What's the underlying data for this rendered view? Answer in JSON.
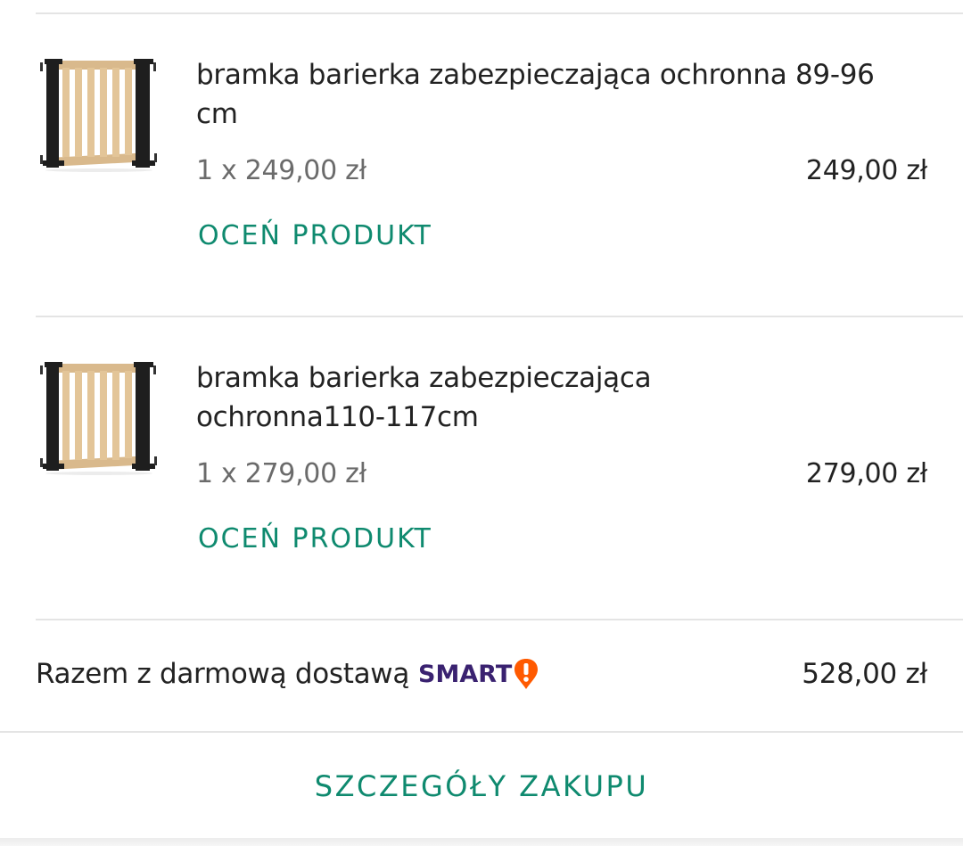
{
  "products": [
    {
      "title_line1": "bramka barierka zabezpieczająca ochronna 89-96",
      "title_line2": "cm",
      "quantity_price": "1 x 249,00 zł",
      "line_total": "249,00 zł",
      "rate_label": "OCEŃ PRODUKT",
      "image_icon": "baby-safety-gate-image"
    },
    {
      "title_line1": "bramka barierka zabezpieczająca",
      "title_line2": "ochronna110-117cm",
      "quantity_price": "1 x 279,00 zł",
      "line_total": "279,00 zł",
      "rate_label": "OCEŃ PRODUKT",
      "image_icon": "baby-safety-gate-image"
    }
  ],
  "summary": {
    "label": "Razem z darmową dostawą",
    "smart_label": "SMART",
    "total": "528,00 zł"
  },
  "details_button": "SZCZEGÓŁY ZAKUPU",
  "colors": {
    "accent": "#0f8a6f",
    "smart_purple": "#3a2270",
    "smart_orange": "#ff5a00",
    "divider": "#e4e4e4",
    "muted_text": "#6b6b6b"
  }
}
